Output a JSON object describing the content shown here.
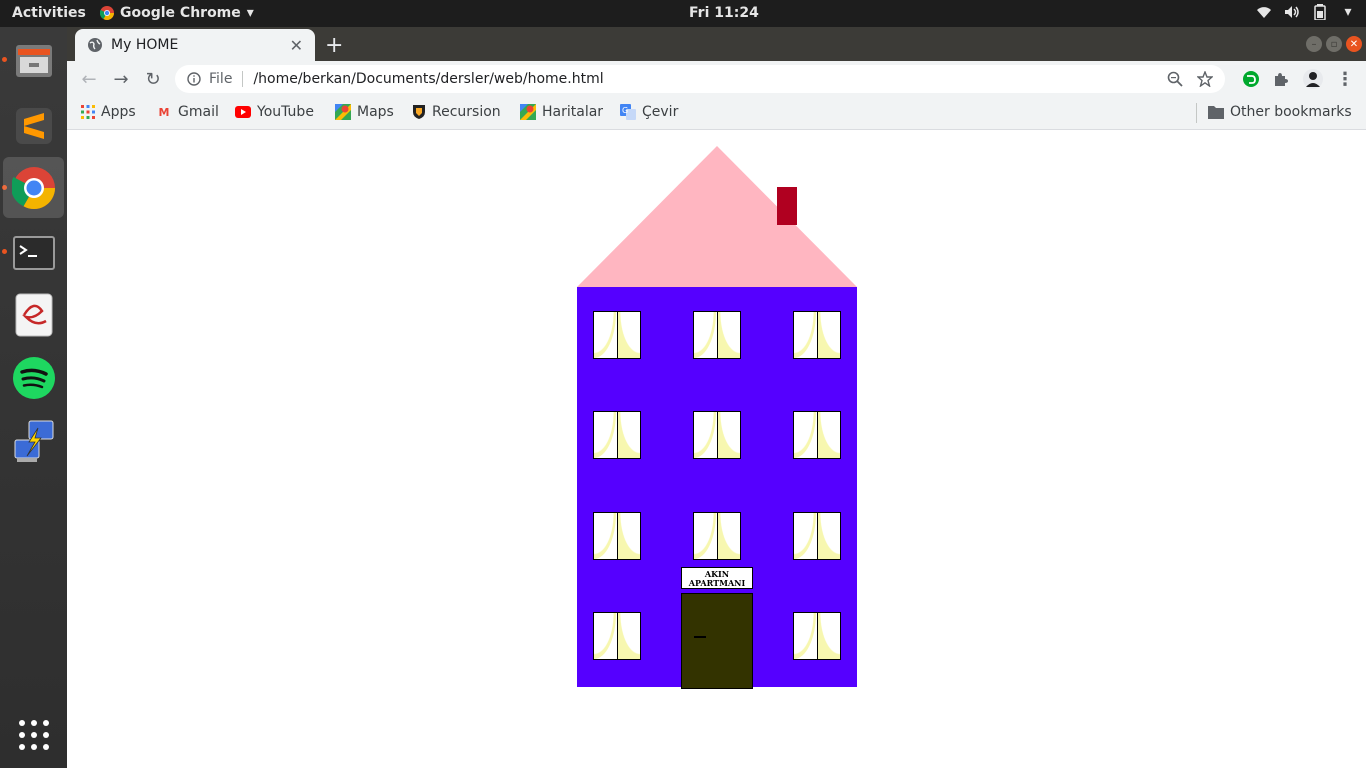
{
  "topbar": {
    "activities": "Activities",
    "app_name": "Google Chrome",
    "clock": "Fri 11:24"
  },
  "dock": {
    "items": [
      "files",
      "sublime-text",
      "chrome",
      "terminal",
      "document-viewer",
      "spotify",
      "network-tool"
    ]
  },
  "browser": {
    "tab_title": "My HOME",
    "new_tab": "+",
    "address": {
      "scheme_label": "File",
      "url": "/home/berkan/Documents/dersler/web/home.html"
    },
    "bookmarks": [
      {
        "label": "Apps",
        "icon": "apps-grid-icon"
      },
      {
        "label": "Gmail",
        "icon": "gmail-icon"
      },
      {
        "label": "YouTube",
        "icon": "youtube-icon"
      },
      {
        "label": "Maps",
        "icon": "maps-icon"
      },
      {
        "label": "Recursion",
        "icon": "recursion-icon"
      },
      {
        "label": "Haritalar",
        "icon": "maps-icon"
      },
      {
        "label": "Çevir",
        "icon": "translate-icon"
      }
    ],
    "other_bookmarks": "Other bookmarks"
  },
  "page": {
    "sign_line1": "AKIN",
    "sign_line2": "APARTMANI",
    "colors": {
      "roof": "#ffb6c1",
      "chimney": "#b00020",
      "building": "#5500ff",
      "door": "#333300",
      "curtain": "#f7f7b0"
    }
  }
}
